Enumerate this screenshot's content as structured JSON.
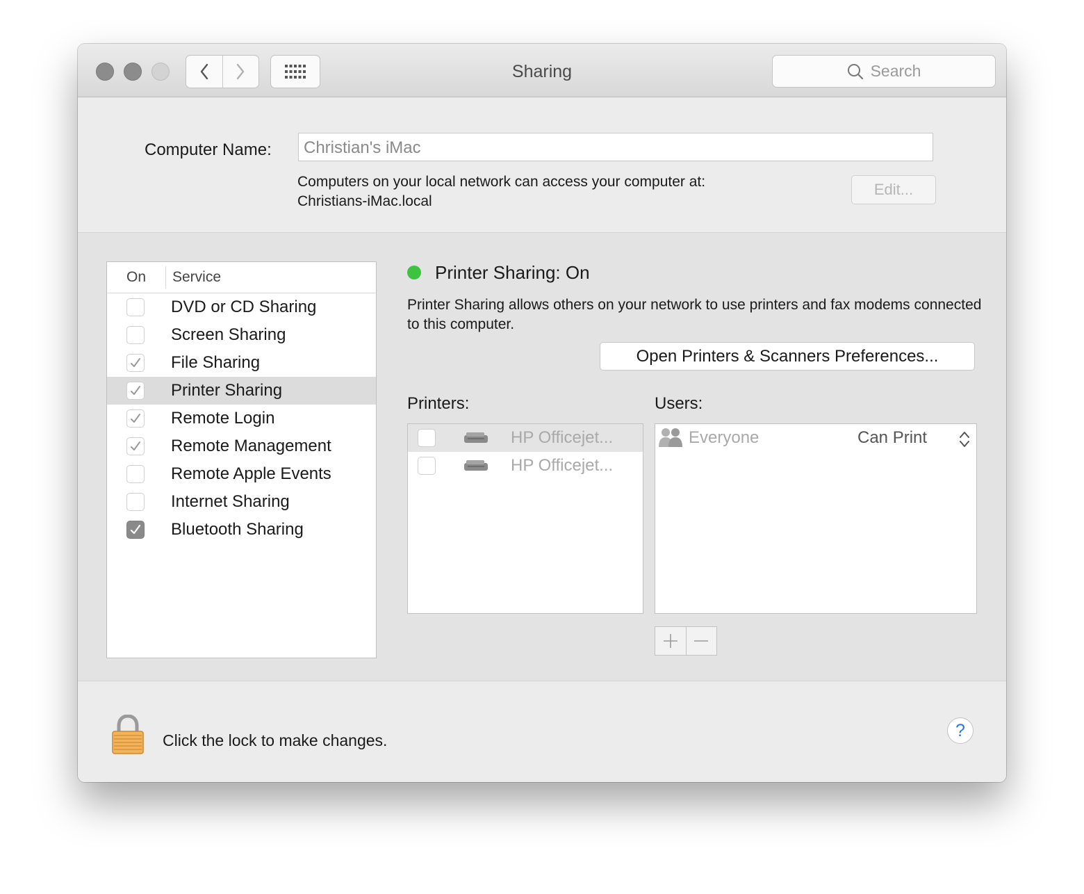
{
  "window": {
    "title": "Sharing",
    "search_placeholder": "Search"
  },
  "computer": {
    "name_label": "Computer Name:",
    "name_value": "Christian's iMac",
    "info_line1": "Computers on your local network can access your computer at:",
    "info_line2": "Christians-iMac.local",
    "edit_label": "Edit..."
  },
  "services": {
    "header_on": "On",
    "header_service": "Service",
    "items": [
      {
        "label": "DVD or CD Sharing",
        "checked": false
      },
      {
        "label": "Screen Sharing",
        "checked": false
      },
      {
        "label": "File Sharing",
        "checked": true
      },
      {
        "label": "Printer Sharing",
        "checked": true,
        "selected": true
      },
      {
        "label": "Remote Login",
        "checked": true
      },
      {
        "label": "Remote Management",
        "checked": true
      },
      {
        "label": "Remote Apple Events",
        "checked": false
      },
      {
        "label": "Internet Sharing",
        "checked": false
      },
      {
        "label": "Bluetooth Sharing",
        "checked": true
      }
    ]
  },
  "detail": {
    "status_title": "Printer Sharing: On",
    "status_color": "#3ec240",
    "description": "Printer Sharing allows others on your network to use printers and fax modems connected to this computer.",
    "open_button": "Open Printers & Scanners Preferences...",
    "printers_label": "Printers:",
    "users_label": "Users:",
    "printers": [
      {
        "name": "HP Officejet...",
        "checked": false
      },
      {
        "name": "HP Officejet...",
        "checked": false
      }
    ],
    "users": [
      {
        "name": "Everyone",
        "permission": "Can Print"
      }
    ]
  },
  "footer": {
    "lock_text": "Click the lock to make changes.",
    "help_label": "?"
  }
}
